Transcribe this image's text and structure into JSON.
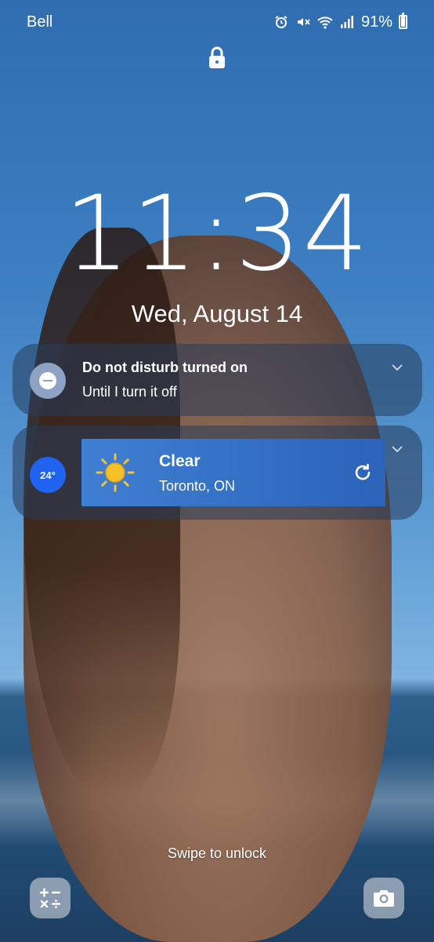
{
  "status_bar": {
    "carrier": "Bell",
    "battery_percent": "91%",
    "icons": [
      "alarm-icon",
      "mute-icon",
      "wifi-icon",
      "signal-icon",
      "battery-icon"
    ]
  },
  "lock_screen": {
    "time": "11:34",
    "date": "Wed, August 14",
    "swipe_hint": "Swipe to unlock"
  },
  "notifications": {
    "dnd": {
      "title": "Do not disturb turned on",
      "subtitle": "Until I turn it off"
    },
    "weather": {
      "temperature": "24°",
      "condition": "Clear",
      "location": "Toronto, ON"
    }
  },
  "shortcuts": {
    "left": "calculator-icon",
    "right": "camera-icon"
  },
  "colors": {
    "temp_badge": "#1f63f0",
    "weather_card": "#2b63b8",
    "dnd_circle": "#8ea2c4"
  }
}
